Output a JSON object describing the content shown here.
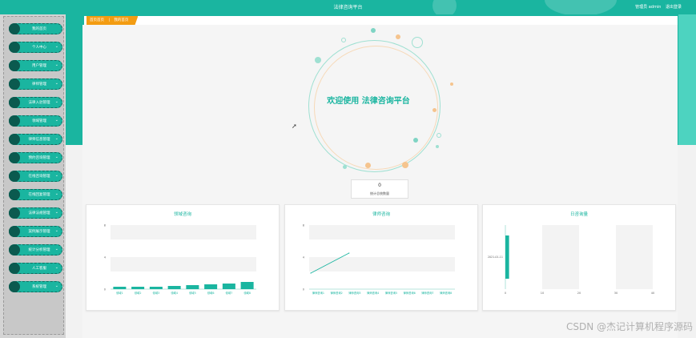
{
  "header": {
    "title": "法律咨询平台",
    "user_label": "管理员 admin",
    "logout_label": "退出登录"
  },
  "colors": {
    "primary": "#1ab5a0",
    "accent": "#f39c12",
    "dark": "#0b5a4f"
  },
  "breadcrumb": {
    "home": "首页首页",
    "current": "我的首页"
  },
  "sidebar": {
    "items": [
      {
        "label": "我的首页",
        "chevron": ""
      },
      {
        "label": "个人中心",
        "chevron": "⌄"
      },
      {
        "label": "用户管理",
        "chevron": "⌄"
      },
      {
        "label": "律师管理",
        "chevron": "⌄"
      },
      {
        "label": "法律入驻管理",
        "chevron": "⌄"
      },
      {
        "label": "领域管理",
        "chevron": "⌄"
      },
      {
        "label": "律师信息管理",
        "chevron": "⌄"
      },
      {
        "label": "预约咨询管理",
        "chevron": "⌄"
      },
      {
        "label": "在线咨询管理",
        "chevron": "⌄"
      },
      {
        "label": "在线回复管理",
        "chevron": "⌄"
      },
      {
        "label": "法律法规管理",
        "chevron": "⌄"
      },
      {
        "label": "案例展示管理",
        "chevron": "⌄"
      },
      {
        "label": "统计分析管理",
        "chevron": "⌄"
      },
      {
        "label": "人工客服",
        "chevron": "⌄"
      },
      {
        "label": "系统管理",
        "chevron": "⌄"
      }
    ]
  },
  "welcome": {
    "text": "欢迎使用 法律咨询平台"
  },
  "stat": {
    "value": "0",
    "caption": "统计总统数量"
  },
  "chart_data": [
    {
      "type": "bar",
      "title": "领域咨询",
      "categories": [
        "领域1",
        "领域2",
        "领域3",
        "领域4",
        "领域5",
        "领域6",
        "领域7",
        "领域8"
      ],
      "values": [
        0.3,
        0.3,
        0.3,
        0.4,
        0.5,
        0.6,
        0.7,
        0.9
      ],
      "ylim": [
        0,
        8
      ],
      "yticks": [
        "0",
        "4",
        "8"
      ]
    },
    {
      "type": "line",
      "title": "律师咨询",
      "categories": [
        "律师咨询1",
        "律师咨询2",
        "律师咨询3",
        "律师咨询4",
        "律师咨询5",
        "律师咨询6",
        "律师咨询7",
        "律师咨询8"
      ],
      "values": [
        2,
        4.5
      ],
      "ylim": [
        0,
        8
      ],
      "yticks": [
        "0",
        "4",
        "8"
      ]
    },
    {
      "type": "bar",
      "title": "日咨询量",
      "orientation": "horizontal",
      "categories": [
        "2021-01-11"
      ],
      "values": [
        1
      ],
      "xlim": [
        0,
        40
      ],
      "xticks": [
        "0",
        "10",
        "20",
        "30",
        "40"
      ]
    }
  ],
  "watermark": "CSDN @杰记计算机程序源码"
}
